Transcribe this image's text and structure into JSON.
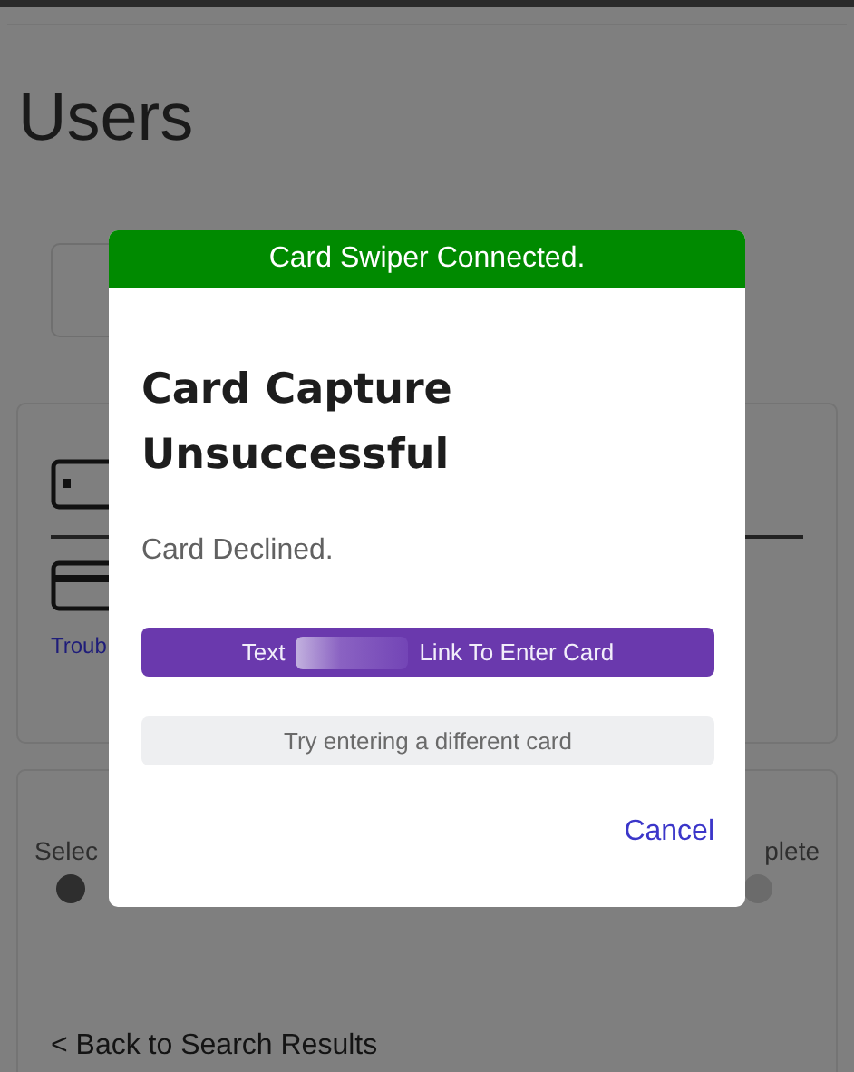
{
  "page": {
    "title": "Users"
  },
  "payment_panel": {
    "link": "Troub"
  },
  "progress": {
    "steps": [
      {
        "label": "Selec",
        "active": true
      },
      {
        "label": "plete",
        "active": false
      }
    ]
  },
  "back_link": "< Back to Search Results",
  "modal": {
    "banner": "Card Swiper Connected.",
    "title": "Card Capture Unsuccessful",
    "message": "Card Declined.",
    "buttons": [
      {
        "kind": "primary",
        "label_start": "Text",
        "label_end": "Link To Enter Card"
      },
      {
        "kind": "secondary",
        "label": "Try entering a different card"
      }
    ],
    "cancel": "Cancel"
  }
}
